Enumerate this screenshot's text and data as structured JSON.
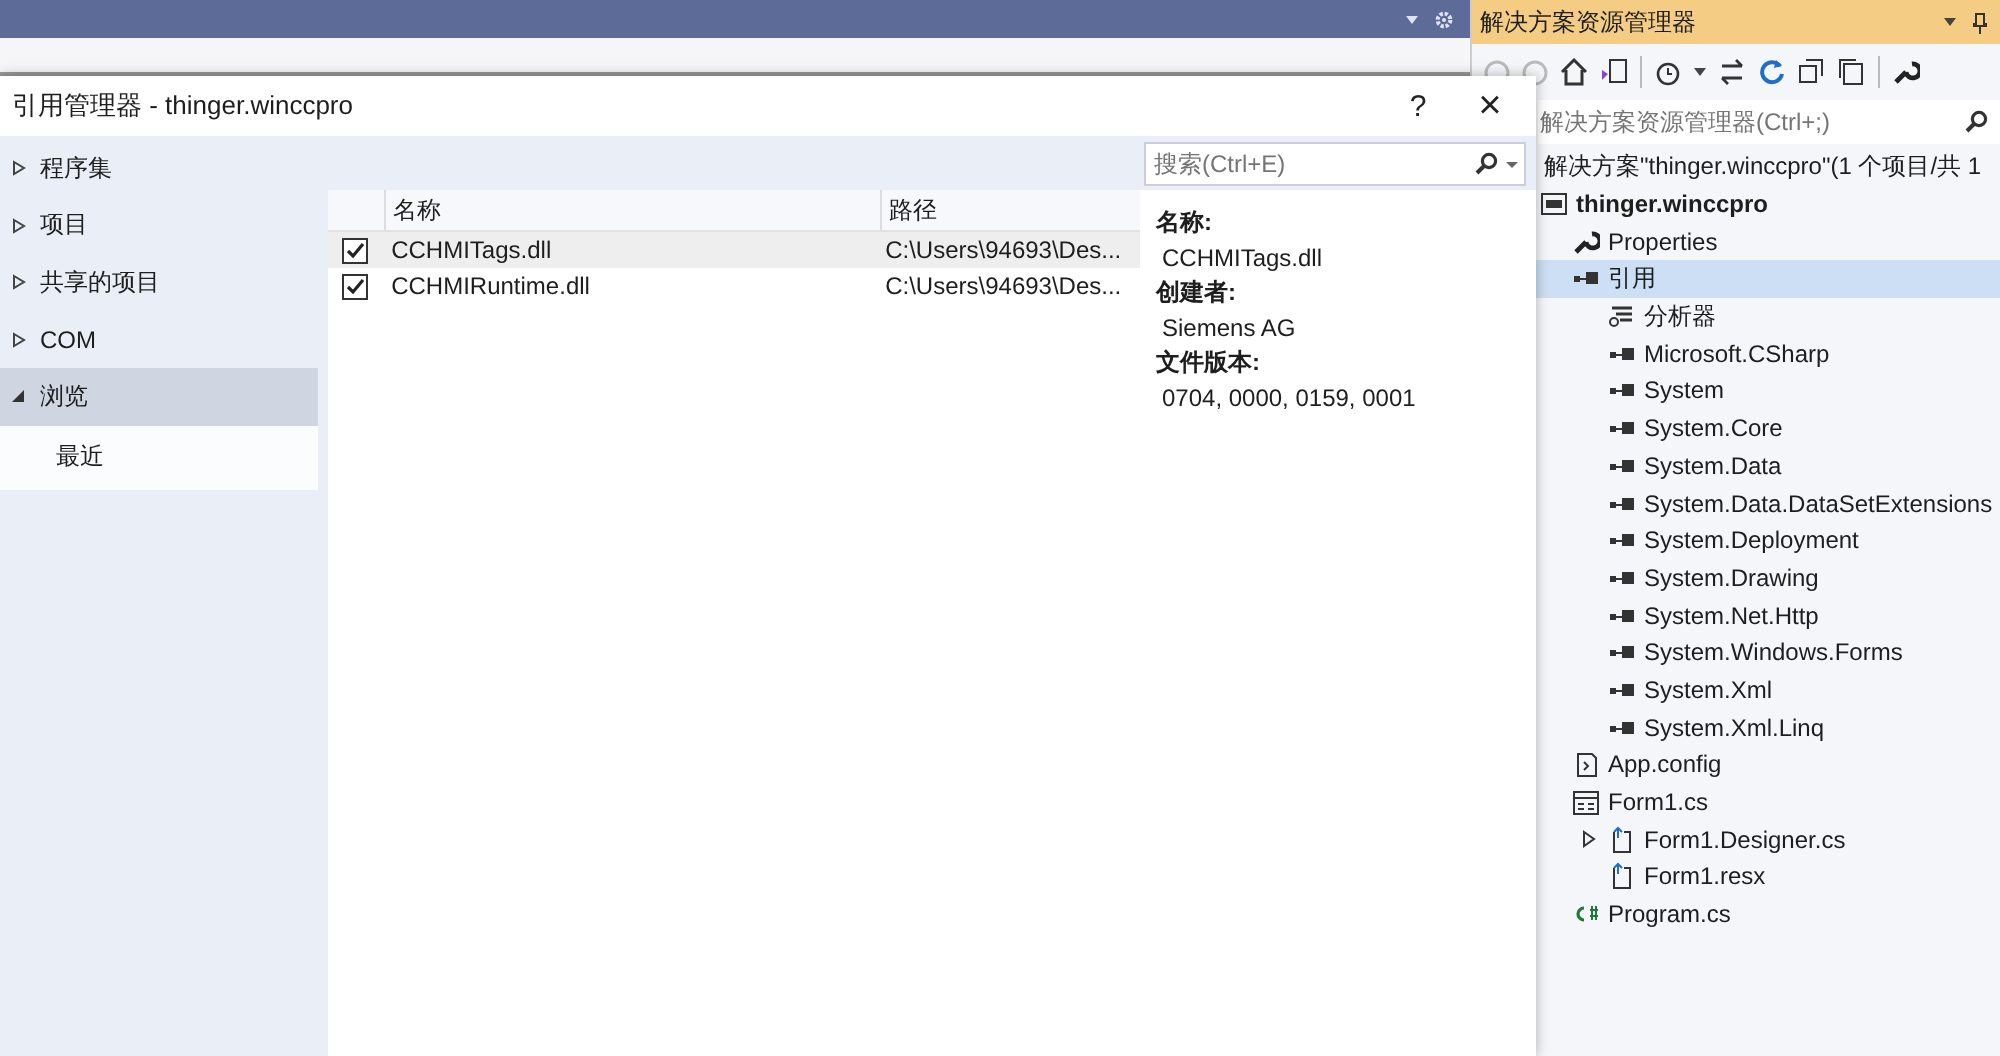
{
  "dialog": {
    "title": "引用管理器 - thinger.winccpro",
    "help": "?",
    "close": "×",
    "nav": [
      {
        "label": "程序集",
        "expanded": false,
        "selected": false
      },
      {
        "label": "项目",
        "expanded": false,
        "selected": false
      },
      {
        "label": "共享的项目",
        "expanded": false,
        "selected": false
      },
      {
        "label": "COM",
        "expanded": false,
        "selected": false
      },
      {
        "label": "浏览",
        "expanded": true,
        "selected": true,
        "children": [
          {
            "label": "最近",
            "selected": false
          }
        ]
      }
    ],
    "search": {
      "placeholder": "搜索(Ctrl+E)"
    },
    "table": {
      "columns": [
        "名称",
        "路径"
      ],
      "rows": [
        {
          "checked": true,
          "selected": true,
          "name": "CCHMITags.dll",
          "path": "C:\\Users\\94693\\Des..."
        },
        {
          "checked": true,
          "selected": false,
          "name": "CCHMIRuntime.dll",
          "path": "C:\\Users\\94693\\Des..."
        }
      ]
    },
    "details": [
      {
        "label": "名称:",
        "value": "CCHMITags.dll"
      },
      {
        "label": "创建者:",
        "value": "Siemens AG"
      },
      {
        "label": "文件版本:",
        "value": "0704, 0000, 0159, 0001"
      }
    ]
  },
  "solution_explorer": {
    "title": "解决方案资源管理器",
    "search": {
      "placeholder": "解决方案资源管理器(Ctrl+;)"
    },
    "tree": [
      {
        "label": "解决方案\"thinger.winccpro\"(1 个项目/共 1",
        "bold": false,
        "selected": false,
        "children": [
          {
            "label": "thinger.winccpro",
            "kind": "project",
            "bold": true,
            "selected": false,
            "children": [
              {
                "label": "Properties",
                "kind": "wrench",
                "bold": false,
                "selected": false,
                "collapsed": false
              },
              {
                "label": "引用",
                "kind": "reference",
                "bold": false,
                "selected": true,
                "collapsed": false,
                "children": [
                  {
                    "label": "分析器",
                    "kind": "analyzer",
                    "bold": false,
                    "selected": false,
                    "collapsed": false
                  },
                  {
                    "label": "Microsoft.CSharp",
                    "kind": "reference",
                    "bold": false,
                    "selected": false,
                    "collapsed": false
                  },
                  {
                    "label": "System",
                    "kind": "reference",
                    "bold": false,
                    "selected": false,
                    "collapsed": false
                  },
                  {
                    "label": "System.Core",
                    "kind": "reference",
                    "bold": false,
                    "selected": false,
                    "collapsed": false
                  },
                  {
                    "label": "System.Data",
                    "kind": "reference",
                    "bold": false,
                    "selected": false,
                    "collapsed": false
                  },
                  {
                    "label": "System.Data.DataSetExtensions",
                    "kind": "reference",
                    "bold": false,
                    "selected": false,
                    "collapsed": false
                  },
                  {
                    "label": "System.Deployment",
                    "kind": "reference",
                    "bold": false,
                    "selected": false,
                    "collapsed": false
                  },
                  {
                    "label": "System.Drawing",
                    "kind": "reference",
                    "bold": false,
                    "selected": false,
                    "collapsed": false
                  },
                  {
                    "label": "System.Net.Http",
                    "kind": "reference",
                    "bold": false,
                    "selected": false,
                    "collapsed": false
                  },
                  {
                    "label": "System.Windows.Forms",
                    "kind": "reference",
                    "bold": false,
                    "selected": false,
                    "collapsed": false
                  },
                  {
                    "label": "System.Xml",
                    "kind": "reference",
                    "bold": false,
                    "selected": false,
                    "collapsed": false
                  },
                  {
                    "label": "System.Xml.Linq",
                    "kind": "reference",
                    "bold": false,
                    "selected": false,
                    "collapsed": false
                  }
                ]
              },
              {
                "label": "App.config",
                "kind": "config",
                "bold": false,
                "selected": false,
                "collapsed": false
              },
              {
                "label": "Form1.cs",
                "kind": "form",
                "bold": false,
                "selected": false,
                "collapsed": false,
                "children": [
                  {
                    "label": "Form1.Designer.cs",
                    "kind": "file",
                    "bold": false,
                    "selected": false,
                    "collapsed": true
                  },
                  {
                    "label": "Form1.resx",
                    "kind": "file",
                    "bold": false,
                    "selected": false,
                    "collapsed": false
                  }
                ]
              },
              {
                "label": "Program.cs",
                "kind": "csharp",
                "bold": false,
                "selected": false,
                "collapsed": false
              }
            ]
          }
        ]
      }
    ]
  }
}
